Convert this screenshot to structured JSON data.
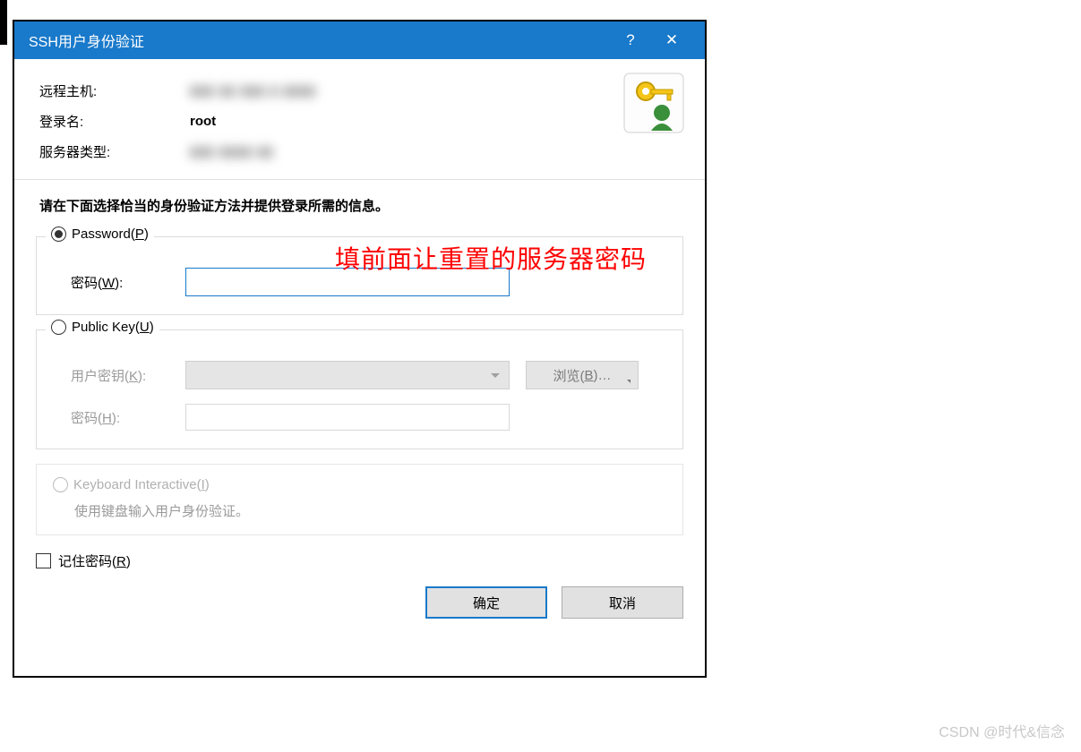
{
  "titlebar": {
    "title": "SSH用户身份验证",
    "help": "?",
    "close": "✕"
  },
  "info": {
    "remote_host_label": "远程主机:",
    "remote_host_value": "▮▮▮ ▮▮ ▮▮▮ ▮ ▮▮▮▮",
    "login_label": "登录名:",
    "login_value": "root",
    "server_type_label": "服务器类型:",
    "server_type_value": "▮▮▮  ▮▮▮▮ ▮▮"
  },
  "instruction": "请在下面选择恰当的身份验证方法并提供登录所需的信息。",
  "annotation": "填前面让重置的服务器密码",
  "password_group": {
    "legend_prefix": "Password(",
    "legend_key": "P",
    "legend_suffix": ")",
    "pwd_label_prefix": "密码(",
    "pwd_label_key": "W",
    "pwd_label_suffix": "):",
    "value": ""
  },
  "publickey_group": {
    "legend_prefix": "Public Key(",
    "legend_key": "U",
    "legend_suffix": ")",
    "userkey_label_prefix": "用户密钥(",
    "userkey_label_key": "K",
    "userkey_label_suffix": "):",
    "browse_prefix": "浏览(",
    "browse_key": "B",
    "browse_suffix": ")…",
    "pwd_label_prefix": "密码(",
    "pwd_label_key": "H",
    "pwd_label_suffix": "):"
  },
  "keyboard_group": {
    "legend_prefix": "Keyboard Interactive(",
    "legend_key": "I",
    "legend_suffix": ")",
    "desc": "使用键盘输入用户身份验证。"
  },
  "remember": {
    "label_prefix": "记住密码(",
    "label_key": "R",
    "label_suffix": ")"
  },
  "buttons": {
    "ok": "确定",
    "cancel": "取消"
  },
  "watermark": "CSDN @时代&信念"
}
